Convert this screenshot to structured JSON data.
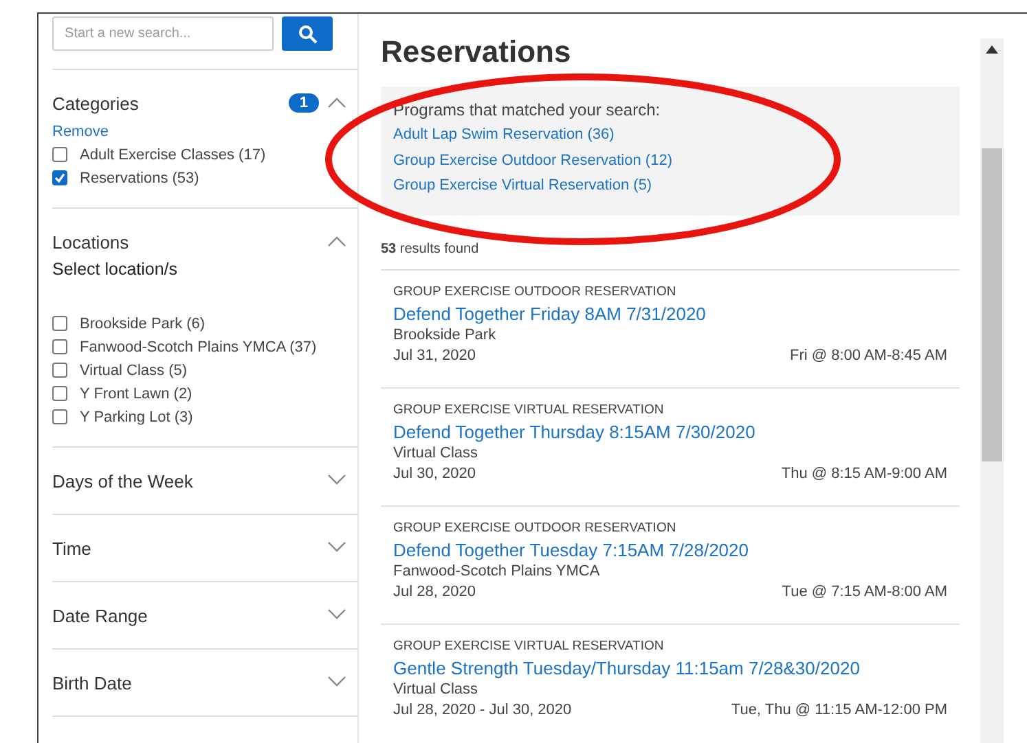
{
  "search": {
    "placeholder": "Start a new search..."
  },
  "filters": [
    {
      "title": "Categories",
      "expanded": true,
      "badge": "1",
      "link": "Remove",
      "items": [
        {
          "label": "Adult Exercise Classes (17)",
          "checked": false
        },
        {
          "label": "Reservations (53)",
          "checked": true
        }
      ]
    },
    {
      "title": "Locations",
      "expanded": true,
      "subtitle": "Select location/s",
      "items": [
        {
          "label": "Brookside Park (6)",
          "checked": false
        },
        {
          "label": "Fanwood-Scotch Plains YMCA (37)",
          "checked": false
        },
        {
          "label": "Virtual Class (5)",
          "checked": false
        },
        {
          "label": "Y Front Lawn (2)",
          "checked": false
        },
        {
          "label": "Y Parking Lot (3)",
          "checked": false
        }
      ]
    },
    {
      "title": "Days of the Week",
      "expanded": false
    },
    {
      "title": "Time",
      "expanded": false
    },
    {
      "title": "Date Range",
      "expanded": false
    },
    {
      "title": "Birth Date",
      "expanded": false
    }
  ],
  "main": {
    "heading": "Reservations",
    "matched": {
      "intro": "Programs that matched your search:",
      "programs": [
        "Adult Lap Swim Reservation (36)",
        "Group Exercise Outdoor Reservation (12)",
        "Group Exercise Virtual Reservation (5)"
      ]
    },
    "results_count": "**53** results found",
    "results": [
      {
        "category": "GROUP EXERCISE OUTDOOR RESERVATION",
        "title": "Defend Together Friday 8AM 7/31/2020",
        "location": "Brookside Park",
        "date": "Jul 31, 2020",
        "time": "Fri @ 8:00 AM-8:45 AM"
      },
      {
        "category": "GROUP EXERCISE VIRTUAL RESERVATION",
        "title": "Defend Together Thursday 8:15AM 7/30/2020",
        "location": "Virtual Class",
        "date": "Jul 30, 2020",
        "time": "Thu @ 8:15 AM-9:00 AM"
      },
      {
        "category": "GROUP EXERCISE OUTDOOR RESERVATION",
        "title": "Defend Together Tuesday 7:15AM 7/28/2020",
        "location": "Fanwood-Scotch Plains YMCA",
        "date": "Jul 28, 2020",
        "time": "Tue @ 7:15 AM-8:00 AM"
      },
      {
        "category": "GROUP EXERCISE VIRTUAL RESERVATION",
        "title": "Gentle Strength Tuesday/Thursday 11:15am 7/28&30/2020",
        "location": "Virtual Class",
        "date": "Jul 28, 2020 - Jul 30, 2020",
        "time": "Tue, Thu @ 11:15 AM-12:00 PM"
      }
    ]
  },
  "annotation": {
    "kind": "ellipse",
    "color": "#e8140f"
  }
}
